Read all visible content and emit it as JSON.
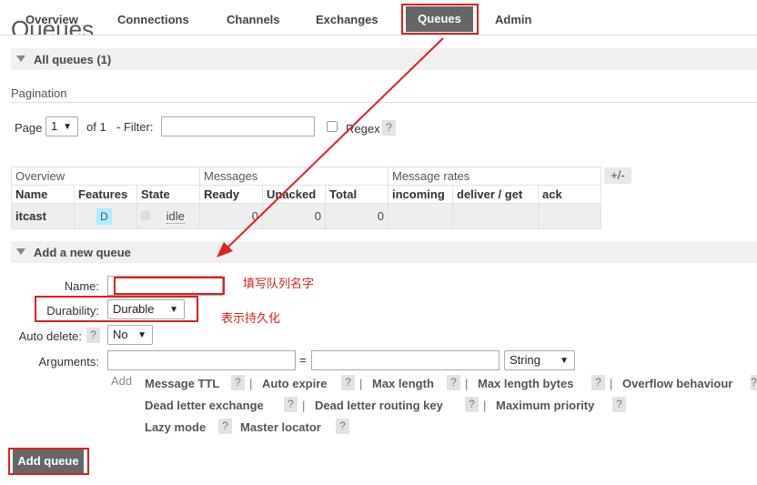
{
  "nav": {
    "tabs": [
      "Overview",
      "Connections",
      "Channels",
      "Exchanges",
      "Queues",
      "Admin"
    ],
    "active": "Queues"
  },
  "page": {
    "title": "Queues"
  },
  "all_queues": {
    "label": "All queues (1)"
  },
  "pagination": {
    "section_label": "Pagination",
    "page_label": "Page",
    "page_value": "1",
    "of_label": "of 1",
    "filter_label": "- Filter:",
    "filter_value": "",
    "regex_label": "Regex",
    "help": "?"
  },
  "table": {
    "group_headers": [
      "Overview",
      "Messages",
      "Message rates"
    ],
    "plus_minus": "+/-",
    "columns": [
      "Name",
      "Features",
      "State",
      "Ready",
      "Unacked",
      "Total",
      "incoming",
      "deliver / get",
      "ack"
    ],
    "rows": [
      {
        "name": "itcast",
        "feature": "D",
        "state": "idle",
        "ready": "0",
        "unacked": "0",
        "total": "0",
        "incoming": "",
        "deliver_get": "",
        "ack": ""
      }
    ]
  },
  "add_queue": {
    "section_label": "Add a new queue",
    "name_label": "Name:",
    "name_value": "",
    "durability_label": "Durability:",
    "durability_value": "Durable",
    "auto_delete_label": "Auto delete:",
    "auto_delete_value": "No",
    "arguments_label": "Arguments:",
    "equals": "=",
    "arg_type_value": "String",
    "add_label": "Add",
    "help": "?",
    "separator": "|",
    "arg_links": [
      "Message TTL",
      "Auto expire",
      "Max length",
      "Max length bytes",
      "Overflow behaviour",
      "Dead letter exchange",
      "Dead letter routing key",
      "Maximum priority",
      "Lazy mode",
      "Master locator"
    ],
    "submit_label": "Add queue"
  },
  "annotations": {
    "name_note": "填写队列名字",
    "durability_note": "表示持久化",
    "color": "#e02020"
  }
}
